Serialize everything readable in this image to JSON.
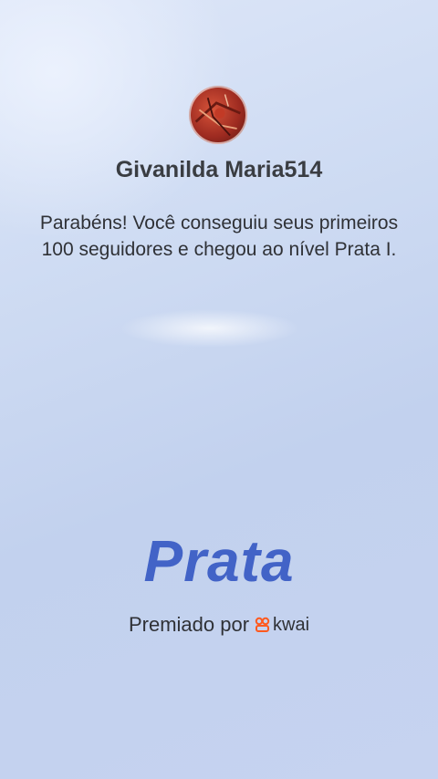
{
  "profile": {
    "username": "Givanilda Maria514"
  },
  "message": "Parabéns! Você conseguiu seus primeiros 100 seguidores e chegou ao nível Prata I.",
  "level": {
    "name": "Prata",
    "color": "#4263c7"
  },
  "footer": {
    "awarded_label": "Premiado por",
    "brand": "kwai",
    "brand_icon": "kwai-logo-icon",
    "brand_color": "#ff5a1f"
  }
}
